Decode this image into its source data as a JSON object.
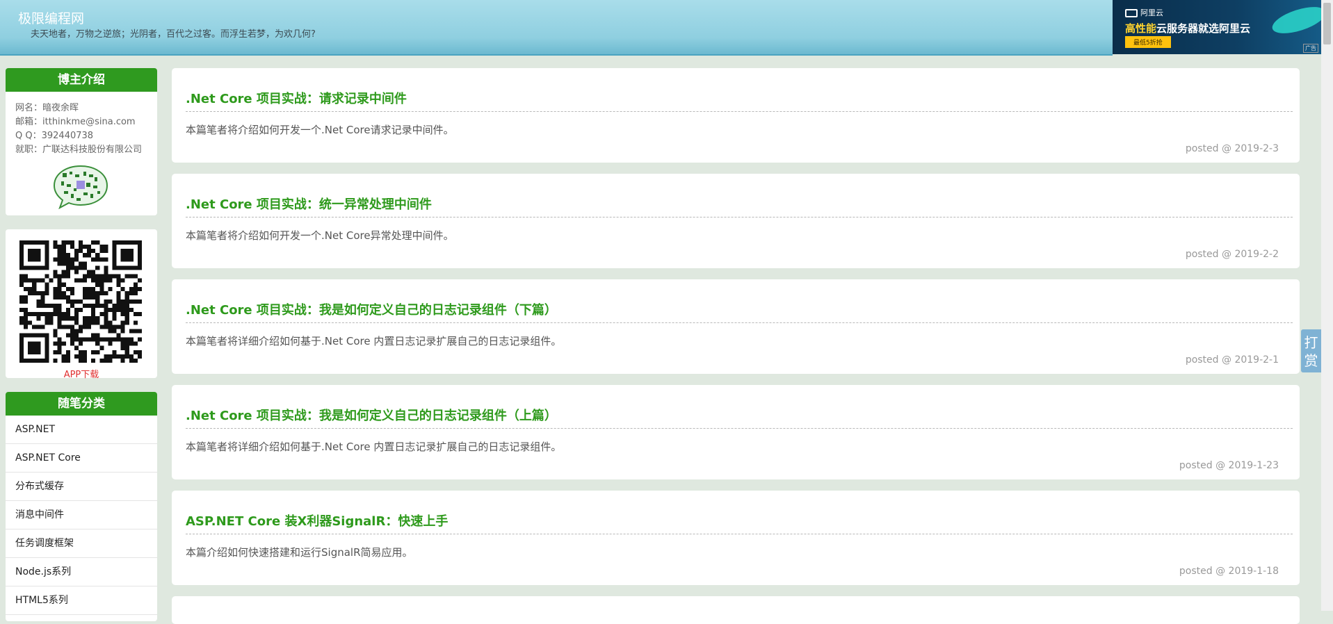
{
  "header": {
    "site_title": "极限编程网",
    "subtitle": "夫天地者，万物之逆旅；光阴者，百代之过客。而浮生若梦，为欢几何?"
  },
  "ad": {
    "brand": "阿里云",
    "headline_highlight": "高性能",
    "headline_rest": "云服务器就选阿里云",
    "button": "最低5折抢",
    "tag": "广告"
  },
  "about": {
    "title": "博主介绍",
    "rows": [
      {
        "label": "网名：",
        "value": "暗夜余晖"
      },
      {
        "label": "邮箱：",
        "value": "itthinkme@sina.com"
      },
      {
        "label": "Q Q：",
        "value": "392440738"
      },
      {
        "label": "就职：",
        "value": "广联达科技股份有限公司"
      }
    ]
  },
  "app": {
    "label": "APP下载"
  },
  "categories": {
    "title": "随笔分类",
    "items": [
      "ASP.NET",
      "ASP.NET Core",
      "分布式缓存",
      "消息中间件",
      "任务调度框架",
      "Node.js系列",
      "HTML5系列"
    ]
  },
  "posts": [
    {
      "title": ".Net Core 项目实战：请求记录中间件",
      "summary": "本篇笔者将介绍如何开发一个.Net Core请求记录中间件。",
      "date": "posted @ 2019-2-3"
    },
    {
      "title": ".Net Core 项目实战：统一异常处理中间件",
      "summary": "本篇笔者将介绍如何开发一个.Net Core异常处理中间件。",
      "date": "posted @ 2019-2-2"
    },
    {
      "title": ".Net Core 项目实战：我是如何定义自己的日志记录组件（下篇）",
      "summary": "本篇笔者将详细介绍如何基于.Net Core 内置日志记录扩展自己的日志记录组件。",
      "date": "posted @ 2019-2-1"
    },
    {
      "title": ".Net Core 项目实战：我是如何定义自己的日志记录组件（上篇）",
      "summary": "本篇笔者将详细介绍如何基于.Net Core 内置日志记录扩展自己的日志记录组件。",
      "date": "posted @ 2019-1-23"
    },
    {
      "title": "ASP.NET Core 装X利器SignalR：快速上手",
      "summary": "本篇介绍如何快速搭建和运行SignalR简易应用。",
      "date": "posted @ 2019-1-18"
    }
  ],
  "tip_button": "打赏",
  "colors": {
    "accent_green": "#2f9a1f",
    "page_bg": "#dfe8df",
    "header_blue": "#8fcfe0"
  }
}
